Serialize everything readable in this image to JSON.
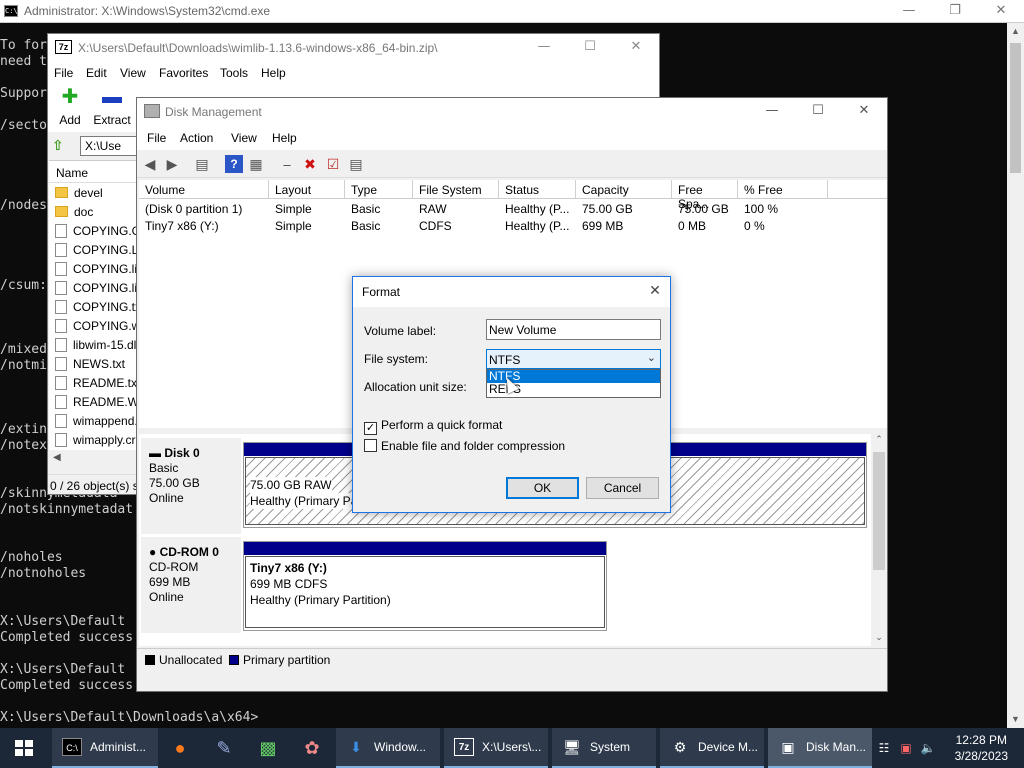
{
  "cmd": {
    "title": "Administrator: X:\\Windows\\System32\\cmd.exe",
    "lines": [
      "To for",
      "need t",
      "",
      "Suppor",
      "",
      "/secto",
      "",
      "",
      "",
      "",
      "/nodes",
      "",
      "",
      "",
      "",
      "/csum:",
      "",
      "",
      "",
      "/mixed",
      "/notmi",
      "",
      "",
      "",
      "/extin",
      "/notex",
      "",
      "",
      "/skinnymetadata",
      "/notskinnymetadat",
      "",
      "",
      "/noholes",
      "/notnoholes",
      "",
      "",
      "X:\\Users\\Default",
      "Completed success",
      "",
      "X:\\Users\\Default",
      "Completed success",
      "",
      "X:\\Users\\Default\\Downloads\\a\\x64>"
    ]
  },
  "zip": {
    "title": "X:\\Users\\Default\\Downloads\\wimlib-1.13.6-windows-x86_64-bin.zip\\",
    "menu": [
      "File",
      "Edit",
      "View",
      "Favorites",
      "Tools",
      "Help"
    ],
    "tools": [
      {
        "label": "Add",
        "icon": "add-icon"
      },
      {
        "label": "Extract",
        "icon": "extract-icon"
      }
    ],
    "address": "X:\\Use",
    "col_name": "Name",
    "files": [
      {
        "name": "devel",
        "type": "folder"
      },
      {
        "name": "doc",
        "type": "folder"
      },
      {
        "name": "COPYING.GP",
        "type": "file"
      },
      {
        "name": "COPYING.LG",
        "type": "file"
      },
      {
        "name": "COPYING.lib",
        "type": "file"
      },
      {
        "name": "COPYING.lib",
        "type": "file"
      },
      {
        "name": "COPYING.tx",
        "type": "file"
      },
      {
        "name": "COPYING.wi",
        "type": "file"
      },
      {
        "name": "libwim-15.dl",
        "type": "file"
      },
      {
        "name": "NEWS.txt",
        "type": "file"
      },
      {
        "name": "README.txt",
        "type": "file"
      },
      {
        "name": "README.WI",
        "type": "file"
      },
      {
        "name": "wimappend.",
        "type": "file"
      },
      {
        "name": "wimapply.cr",
        "type": "file"
      }
    ],
    "status": "0 / 26 object(s) s"
  },
  "dm": {
    "title": "Disk Management",
    "menu": [
      "File",
      "Action",
      "View",
      "Help"
    ],
    "columns": [
      "Volume",
      "Layout",
      "Type",
      "File System",
      "Status",
      "Capacity",
      "Free Spa...",
      "% Free"
    ],
    "volumes": [
      [
        "(Disk 0 partition 1)",
        "Simple",
        "Basic",
        "RAW",
        "Healthy (P...",
        "75.00 GB",
        "75.00 GB",
        "100 %"
      ],
      [
        "Tiny7 x86 (Y:)",
        "Simple",
        "Basic",
        "CDFS",
        "Healthy (P...",
        "699 MB",
        "0 MB",
        "0 %"
      ]
    ],
    "disk0": {
      "name": "Disk 0",
      "type": "Basic",
      "size": "75.00 GB",
      "state": "Online",
      "part_line1": "75.00 GB RAW",
      "part_line2": "Healthy (Primary Pa"
    },
    "cdrom0": {
      "name": "CD-ROM 0",
      "type": "CD-ROM",
      "size": "699 MB",
      "state": "Online",
      "part_title": "Tiny7 x86  (Y:)",
      "part_line1": "699 MB CDFS",
      "part_line2": "Healthy (Primary Partition)"
    },
    "legend": {
      "unallocated": "Unallocated",
      "primary": "Primary partition",
      "unallocated_color": "#000000",
      "primary_color": "#00008b"
    }
  },
  "format": {
    "title": "Format",
    "volume_label_lbl": "Volume label:",
    "volume_label_val": "New Volume",
    "fs_lbl": "File system:",
    "fs_val": "NTFS",
    "fs_options": [
      "NTFS",
      "REFS"
    ],
    "alloc_lbl": "Allocation unit size:",
    "quick_format": "Perform a quick format",
    "compression": "Enable file and folder compression",
    "quick_checked": true,
    "compression_checked": false,
    "ok": "OK",
    "cancel": "Cancel",
    "accent": "#0078d7"
  },
  "taskbar": {
    "tasks": [
      {
        "label": "Administ...",
        "icon": "cmd-icon"
      },
      {
        "label": "Window...",
        "icon": "download-icon"
      },
      {
        "label": "X:\\Users\\...",
        "icon": "7zip-icon"
      },
      {
        "label": "System",
        "icon": "system-icon"
      },
      {
        "label": "Device M...",
        "icon": "device-manager-icon"
      },
      {
        "label": "Disk Man...",
        "icon": "disk-management-icon"
      }
    ],
    "time": "12:28 PM",
    "date": "3/28/2023"
  }
}
